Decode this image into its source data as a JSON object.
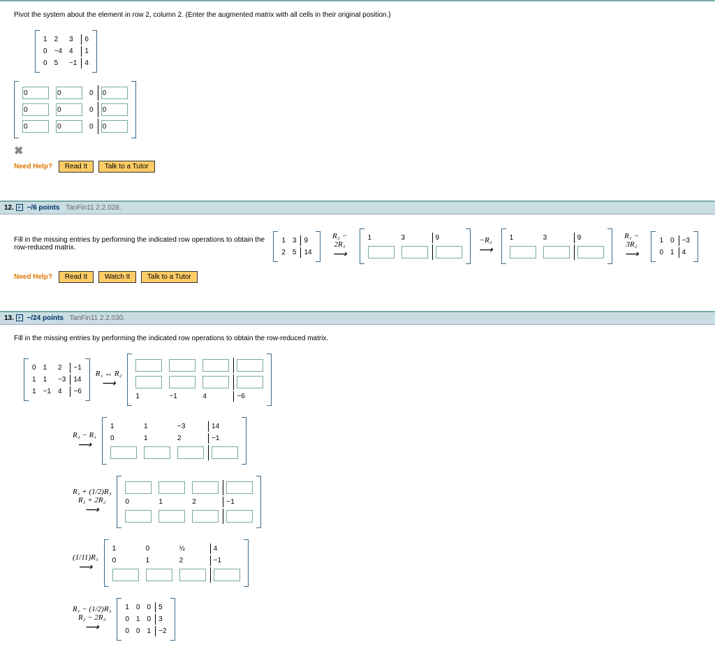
{
  "q11": {
    "instr": "Pivot the system about the element in row 2, column 2. (Enter the augmented matrix with all cells in their original position.)",
    "m": [
      [
        "1",
        "2",
        "3",
        "6"
      ],
      [
        "0",
        "−4",
        "4",
        "1"
      ],
      [
        "0",
        "5",
        "−1",
        "4"
      ]
    ],
    "need": "Need Help?",
    "read": "Read It",
    "tutor": "Talk to a Tutor"
  },
  "q12": {
    "num": "12.",
    "pts": "−/6 points",
    "src": "TanFin11 2.2.028.",
    "instr": "Fill in the missing entries by performing the indicated row operations to obtain the row-reduced matrix.",
    "m1": [
      [
        "1",
        "3",
        "9"
      ],
      [
        "2",
        "5",
        "14"
      ]
    ],
    "op1a": "R",
    "op1": "₂ − 2R₁",
    "m2r1": [
      "1",
      "3",
      "9"
    ],
    "op2": "−R₂",
    "m3r1": [
      "1",
      "3",
      "9"
    ],
    "op3": "R₁ − 3R₂",
    "m4": [
      [
        "1",
        "0",
        "−3"
      ],
      [
        "0",
        "1",
        "4"
      ]
    ],
    "need": "Need Help?",
    "read": "Read It",
    "watch": "Watch It",
    "tutor": "Talk to a Tutor"
  },
  "q13": {
    "num": "13.",
    "pts": "−/24 points",
    "src": "TanFin11 2.2.030.",
    "instr": "Fill in the missing entries by performing the indicated row operations to obtain the row-reduced matrix.",
    "m1": [
      [
        "0",
        "1",
        "2",
        "−1"
      ],
      [
        "1",
        "1",
        "−3",
        "14"
      ],
      [
        "1",
        "−1",
        "4",
        "−6"
      ]
    ],
    "op1": "R₁ ↔ R₂",
    "s1r3": [
      "1",
      "−1",
      "4",
      "−6"
    ],
    "op2": "R₃ − R₁",
    "s2r1": [
      "1",
      "1",
      "−3",
      "14"
    ],
    "s2r2": [
      "0",
      "1",
      "2",
      "−1"
    ],
    "op3a": "R₁ + (1/2)R₃",
    "op3b": "R₃ + 2R₂",
    "s3r2": [
      "0",
      "1",
      "2",
      "−1"
    ],
    "op4": "(1/11)R₃",
    "s4r1": [
      "1",
      "0",
      "½",
      "4"
    ],
    "s4r2": [
      "0",
      "1",
      "2",
      "−1"
    ],
    "op5a": "R₁ − (1/2)R₃",
    "op5b": "R₂ − 2R₃",
    "m5": [
      [
        "1",
        "0",
        "0",
        "5"
      ],
      [
        "0",
        "1",
        "0",
        "3"
      ],
      [
        "0",
        "0",
        "1",
        "−2"
      ]
    ]
  }
}
